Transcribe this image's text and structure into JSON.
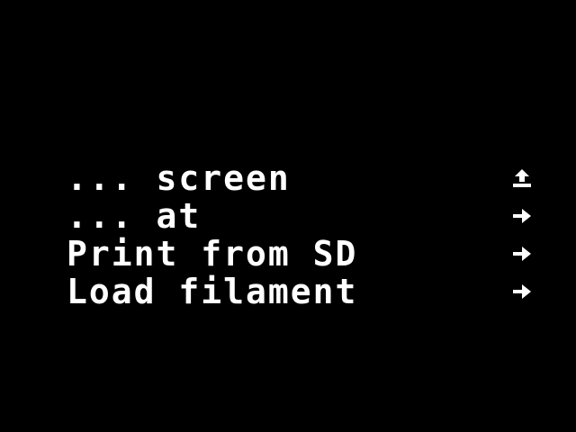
{
  "screen": {
    "background": "#000000",
    "foreground": "#ffffff"
  },
  "menu": {
    "items": [
      {
        "label": "... screen",
        "icon": "back-arrow-icon"
      },
      {
        "label": "... at",
        "icon": "right-arrow-icon"
      },
      {
        "label": "Print from SD",
        "icon": "right-arrow-icon"
      },
      {
        "label": "Load filament",
        "icon": "right-arrow-icon"
      }
    ]
  }
}
